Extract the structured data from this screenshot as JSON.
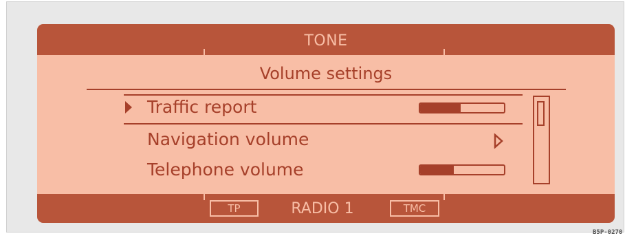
{
  "header": {
    "title": "TONE"
  },
  "menu": {
    "heading": "Volume settings",
    "items": [
      {
        "label": "Traffic report",
        "selected": true,
        "level": 0.48
      },
      {
        "label": "Navigation volume",
        "submenu": true
      },
      {
        "label": "Telephone volume",
        "level": 0.4
      }
    ]
  },
  "scrollbar": {
    "position": 0
  },
  "status": {
    "tp": "TP",
    "source": "RADIO 1",
    "tmc": "TMC"
  },
  "image_code": "B5P-0270",
  "colors": {
    "screen_bg": "#f8bea6",
    "bar_bg": "#b8553a",
    "foreground": "#a6402a"
  }
}
